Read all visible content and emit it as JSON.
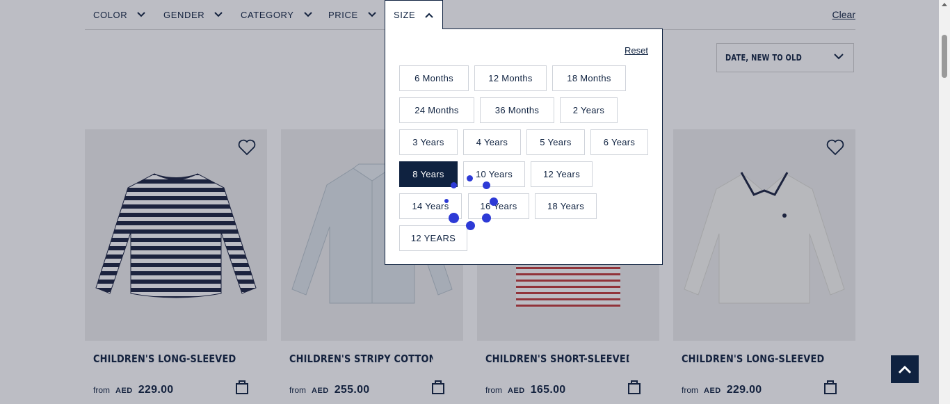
{
  "filters": {
    "color": "COLOR",
    "gender": "GENDER",
    "category": "CATEGORY",
    "price": "PRICE",
    "size": "SIZE",
    "clear": "Clear"
  },
  "sort": {
    "label": "DATE, NEW TO OLD"
  },
  "size_panel": {
    "reset": "Reset",
    "options": [
      {
        "label": "6 Months",
        "selected": false
      },
      {
        "label": "12 Months",
        "selected": false
      },
      {
        "label": "18 Months",
        "selected": false
      },
      {
        "label": "24 Months",
        "selected": false
      },
      {
        "label": "36 Months",
        "selected": false
      },
      {
        "label": "2 Years",
        "selected": false
      },
      {
        "label": "3 Years",
        "selected": false
      },
      {
        "label": "4 Years",
        "selected": false
      },
      {
        "label": "5 Years",
        "selected": false
      },
      {
        "label": "6 Years",
        "selected": false
      },
      {
        "label": "8 Years",
        "selected": true
      },
      {
        "label": "10 Years",
        "selected": false
      },
      {
        "label": "12 Years",
        "selected": false
      },
      {
        "label": "14 Years",
        "selected": false
      },
      {
        "label": "16 Years",
        "selected": false
      },
      {
        "label": "18 Years",
        "selected": false
      },
      {
        "label": "12 YEARS",
        "selected": false
      }
    ]
  },
  "products": [
    {
      "title": "CHILDREN'S LONG-SLEEVED STRIP...",
      "from": "from",
      "currency": "AED",
      "price": "229.00"
    },
    {
      "title": "CHILDREN'S STRIPY COTTON SHIRT",
      "from": "from",
      "currency": "AED",
      "price": "255.00"
    },
    {
      "title": "CHILDREN'S SHORT-SLEEVED...",
      "from": "from",
      "currency": "AED",
      "price": "165.00"
    },
    {
      "title": "CHILDREN'S LONG-SLEEVED...",
      "from": "from",
      "currency": "AED",
      "price": "229.00"
    }
  ],
  "icons": {
    "heart": "heart-icon",
    "bag": "shopping-bag-icon",
    "chevron": "chevron-down-icon",
    "back_to_top": "chevron-up-icon"
  },
  "colors": {
    "navy": "#0f2240",
    "image_bg": "#eeeeee",
    "chip_border": "#cfd3da",
    "click_dot": "#2d3ad6"
  }
}
